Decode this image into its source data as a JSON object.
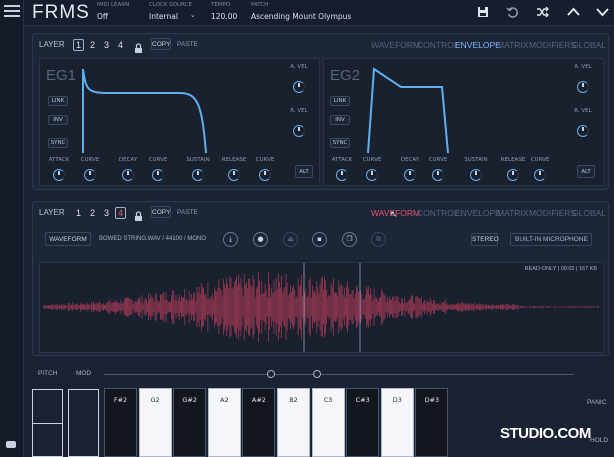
{
  "header": {
    "logo": "FRMS",
    "midi_learn": {
      "label": "MIDI LEARN",
      "value": "Off"
    },
    "clock_source": {
      "label": "CLOCK SOURCE",
      "value": "Internal"
    },
    "tempo": {
      "label": "TEMPO",
      "value": "120.00"
    },
    "patch": {
      "label": "PATCH",
      "value": "Ascending Mount Olympus"
    }
  },
  "layer_panel_1": {
    "layer_label": "LAYER",
    "layers": [
      "1",
      "2",
      "3",
      "4"
    ],
    "copy_label": "COPY",
    "paste_label": "PASTE",
    "tabs": [
      "WAVEFORM",
      "CONTROL",
      "ENVELOPE",
      "MATRIX",
      "MODIFIERS",
      "GLOBAL"
    ],
    "active_tab": "ENVELOPE",
    "eg1": {
      "title": "EG1",
      "buttons": [
        "LINK",
        "INV",
        "SYNC"
      ],
      "side_knobs": [
        "A. VEL",
        "R. VEL"
      ],
      "knobs": [
        "ATTACK",
        "CURVE",
        "DECAY",
        "CURVE",
        "SUSTAIN",
        "RELEASE",
        "CURVE"
      ],
      "alt": "ALT"
    },
    "eg2": {
      "title": "EG2",
      "buttons": [
        "LINK",
        "INV",
        "SYNC"
      ],
      "side_knobs": [
        "A. VEL",
        "R. VEL"
      ],
      "knobs": [
        "ATTACK",
        "CURVE",
        "DECAY",
        "CURVE",
        "SUSTAIN",
        "RELEASE",
        "CURVE"
      ],
      "alt": "ALT"
    }
  },
  "layer_panel_2": {
    "layer_label": "LAYER",
    "layers": [
      "1",
      "2",
      "3",
      "4"
    ],
    "copy_label": "COPY",
    "paste_label": "PASTE",
    "tabs": [
      "WAVEFORM",
      "CONTROL",
      "ENVELOPE",
      "MATRIX",
      "MODIFIERS",
      "GLOBAL"
    ],
    "active_tab": "WAVEFORM",
    "waveform_button": "WAVEFORM",
    "file_info": "BOWED STRING.WAV / 44100 / MONO",
    "stereo_button": "STEREO",
    "input_select": "BUILT-IN MICROPHONE",
    "status": "READ-ONLY | 00:02 | 167 KB"
  },
  "keyboard": {
    "pitch_label": "PITCH",
    "mod_label": "MOD",
    "keys": [
      {
        "note": "F#2",
        "type": "black"
      },
      {
        "note": "G2",
        "type": "white"
      },
      {
        "note": "G#2",
        "type": "black"
      },
      {
        "note": "A2",
        "type": "white"
      },
      {
        "note": "A#2",
        "type": "black"
      },
      {
        "note": "B2",
        "type": "white"
      },
      {
        "note": "C3",
        "type": "white"
      },
      {
        "note": "C#3",
        "type": "black"
      },
      {
        "note": "D3",
        "type": "white"
      },
      {
        "note": "D#3",
        "type": "black"
      }
    ],
    "panic_label": "PANIC",
    "hold_label": "HOLD",
    "watermark": "STUDIO.COM"
  },
  "colors": {
    "accent_blue": "#7fb8ff",
    "accent_red": "#e0536a",
    "background": "#1a2233"
  },
  "icons": {
    "header": [
      "save-icon",
      "undo-icon",
      "shuffle-icon",
      "chevron-up-icon",
      "chevron-down-icon"
    ],
    "waveform_tools": [
      "download-icon",
      "record-icon",
      "eject-icon",
      "delete-icon",
      "copy-icon",
      "link-icon"
    ]
  }
}
